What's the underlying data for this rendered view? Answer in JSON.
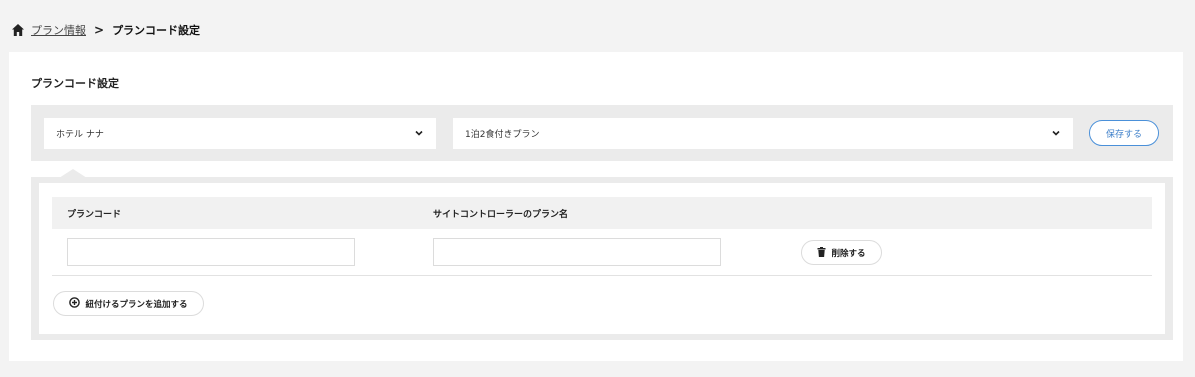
{
  "breadcrumb": {
    "home_icon": "home-icon",
    "parent": "プラン情報",
    "separator": ">",
    "current": "プランコード設定"
  },
  "section": {
    "title": "プランコード設定"
  },
  "filters": {
    "hotel_select": {
      "value": "ホテル ナナ",
      "icon": "chevron-down-icon"
    },
    "plan_select": {
      "value": "1泊2食付きプラン",
      "icon": "chevron-down-icon"
    },
    "save_label": "保存する"
  },
  "table": {
    "headers": [
      "プランコード",
      "サイトコントローラーのプラン名"
    ],
    "rows": [
      {
        "plan_code": "",
        "site_controller_plan_name": ""
      }
    ],
    "delete_label": "削除する",
    "delete_icon": "trash-icon"
  },
  "add_plan": {
    "label": "紐付けるプランを追加する",
    "icon": "plus-circle-icon"
  },
  "colors": {
    "accent": "#3d7fc9",
    "background": "#f3f3f3",
    "panel": "#ebebeb"
  }
}
